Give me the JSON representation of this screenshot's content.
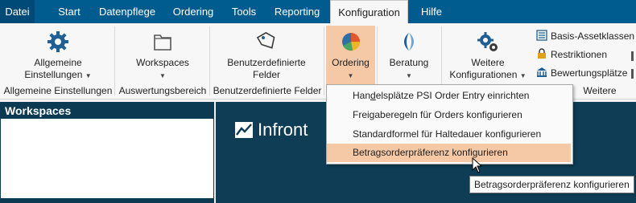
{
  "tabs": {
    "datei": "Datei",
    "start": "Start",
    "datenpflege": "Datenpflege",
    "ordering": "Ordering",
    "tools": "Tools",
    "reporting": "Reporting",
    "konfiguration": "Konfiguration",
    "hilfe": "Hilfe"
  },
  "ribbon": {
    "allgemeine": {
      "line1": "Allgemeine",
      "line2": "Einstellungen",
      "group": "Allgemeine Einstellungen",
      "icon": "gear-icon"
    },
    "workspaces": {
      "line1": "Workspaces",
      "group": "Auswertungsbereich",
      "icon": "folder-icon"
    },
    "felder": {
      "line1": "Benutzerdefinierte",
      "line2": "Felder",
      "group": "Benutzerdefinierte Felder",
      "icon": "tag-icon"
    },
    "ordering": {
      "line1": "Ordering",
      "icon": "pie-chart-icon"
    },
    "beratung": {
      "line1": "Beratung",
      "icon": "beratung-icon"
    },
    "weitere": {
      "line1": "Weitere",
      "line2": "Konfigurationen",
      "group": "Weitere",
      "icon": "gears-icon"
    },
    "small": {
      "basis": "Basis-Assetklassen",
      "restriktionen": "Restriktionen",
      "bewertung": "Bewertungsplätze"
    }
  },
  "panel": {
    "title": "Workspaces"
  },
  "logo": {
    "text": "Infront"
  },
  "menu": {
    "items": [
      {
        "pre": "Han",
        "accel": "d",
        "post": "elsplätze PSI Order Entry einrichten"
      },
      {
        "pre": "",
        "accel": "",
        "post": "Freigaberegeln für Orders konfigurieren"
      },
      {
        "pre": "",
        "accel": "",
        "post": "Standardformel für Haltedauer konfigurieren"
      },
      {
        "pre": "",
        "accel": "",
        "post": "Betragsorderpräferenz konfigurieren"
      }
    ],
    "hovered_index": 3
  },
  "tooltip": "Betragsorderpräferenz konfigurieren",
  "colors": {
    "tabbar": "#005b8e",
    "accent": "#f6c9a6",
    "dark": "#0f3d55"
  }
}
